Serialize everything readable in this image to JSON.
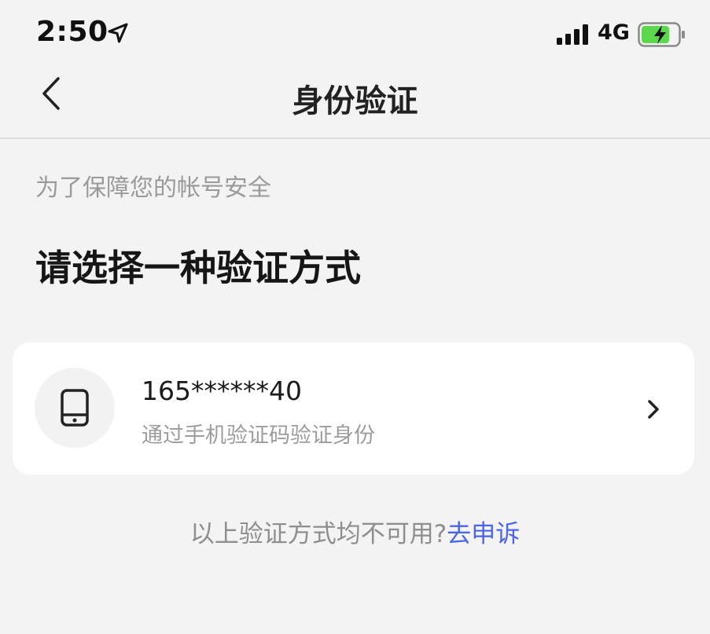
{
  "status": {
    "time": "2:50",
    "network": "4G"
  },
  "nav": {
    "title": "身份验证"
  },
  "subtitle": "为了保障您的帐号安全",
  "heading": "请选择一种验证方式",
  "option": {
    "phone": "165******40",
    "description": "通过手机验证码验证身份"
  },
  "footer": {
    "text": "以上验证方式均不可用?",
    "link": "去申诉"
  },
  "colors": {
    "link": "#4a66e6",
    "battery_charging": "#5dd84e"
  }
}
